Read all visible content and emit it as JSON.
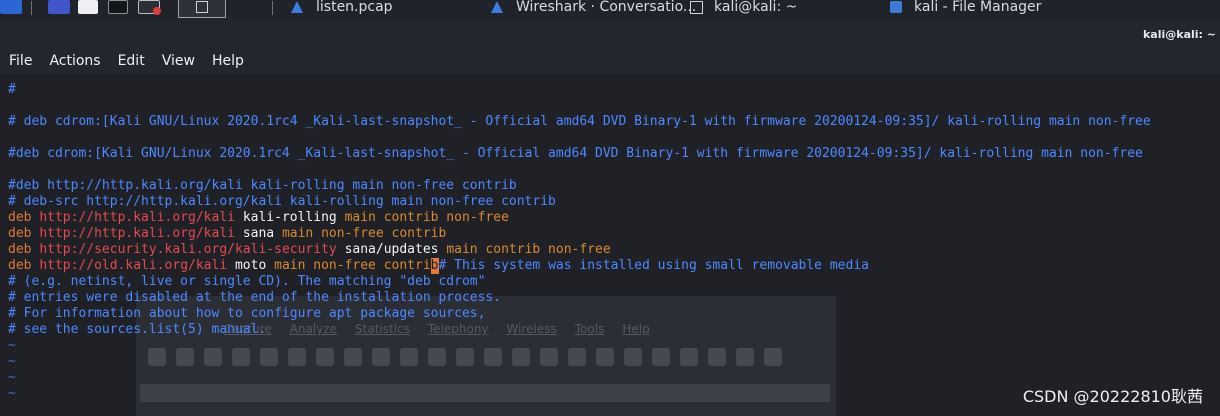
{
  "taskbar": {
    "tasks": [
      {
        "label": "listen.pcap"
      },
      {
        "label": "Wireshark · Conversatio..."
      },
      {
        "label": "kali@kali: ~"
      },
      {
        "label": "kali - File Manager"
      }
    ]
  },
  "window": {
    "title": "kali@kali: ~"
  },
  "menu": {
    "items": [
      "File",
      "Actions",
      "Edit",
      "View",
      "Help"
    ]
  },
  "terminal": {
    "lines": {
      "l1": "#",
      "l2": "# deb cdrom:[Kali GNU/Linux 2020.1rc4 _Kali-last-snapshot_ - Official amd64 DVD Binary-1 with firmware 20200124-09:35]/ kali-rolling main non-free",
      "l3": "#deb cdrom:[Kali GNU/Linux 2020.1rc4 _Kali-last-snapshot_ - Official amd64 DVD Binary-1 with firmware 20200124-09:35]/ kali-rolling main non-free",
      "l4": "#deb http://http.kali.org/kali kali-rolling main non-free contrib",
      "l5": "# deb-src http://http.kali.org/kali kali-rolling main non-free contrib",
      "l6": {
        "deb": "deb",
        "url": "http://http.kali.org/kali",
        "suite": "kali-rolling",
        "components": "main contrib non-free"
      },
      "l7": {
        "deb": "deb",
        "url": "http://http.kali.org/kali",
        "suite": "sana",
        "components": "main non-free contrib"
      },
      "l8": {
        "deb": "deb",
        "url": "http://security.kali.org/kali-security",
        "suite": "sana/updates",
        "components": "main contrib non-free"
      },
      "l9": {
        "deb": "deb",
        "url": "http://old.kali.org/kali",
        "suite": "moto",
        "components_before_cursor": "main non-free contri",
        "cursor_char": "b",
        "comment": "# This system was installed using small removable media"
      },
      "l10": "# (e.g. netinst, live or single CD). The matching \"deb cdrom\"",
      "l11": "# entries were disabled at the end of the installation process.",
      "l12": "# For information about how to configure apt package sources,",
      "l13": "# see the sources.list(5) manual.",
      "tilde": "~"
    }
  },
  "background_window": {
    "menu": [
      "Capture",
      "Analyze",
      "Statistics",
      "Telephony",
      "Wireless",
      "Tools",
      "Help"
    ]
  },
  "watermark": "CSDN @20222810耿茜",
  "colors": {
    "comment": "#4e88ff",
    "deb_keyword": "#e07a3a",
    "url": "#e34b4b",
    "suite": "#f4f4f4",
    "components": "#d9892f",
    "background": "#202127"
  }
}
